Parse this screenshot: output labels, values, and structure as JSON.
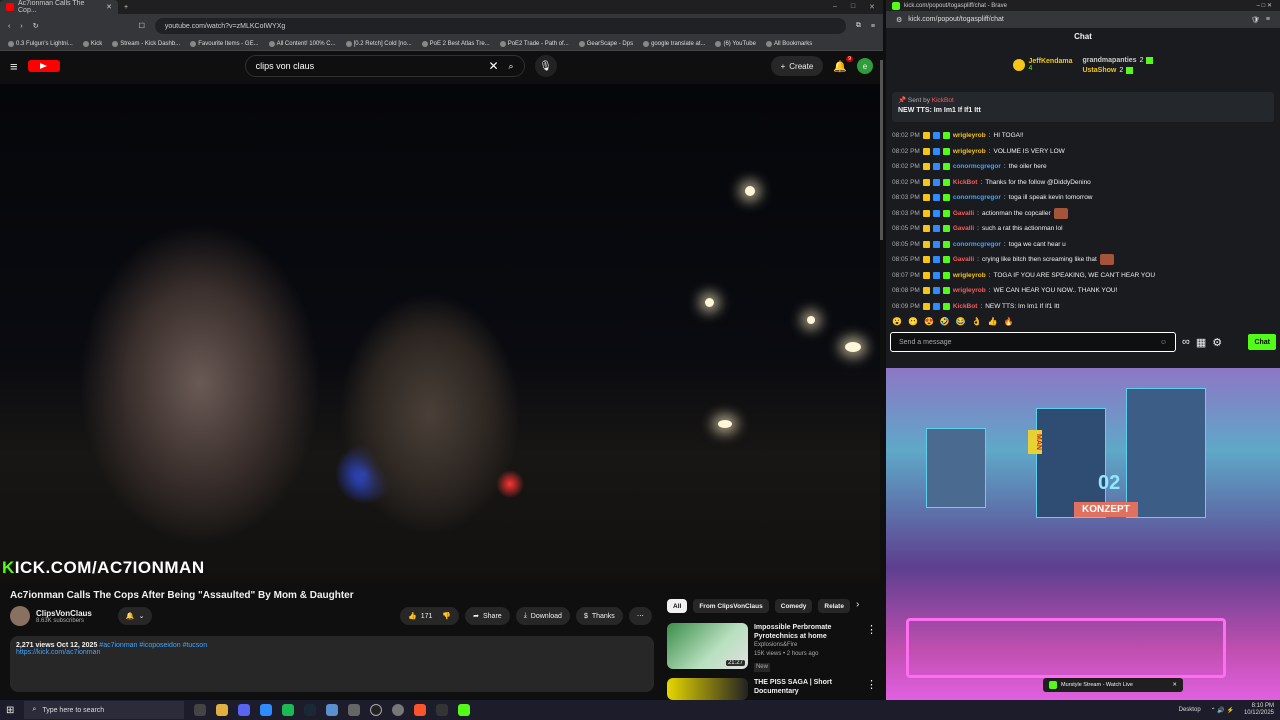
{
  "yt_browser": {
    "tab_title": "Ac7ionman Calls The Cop...",
    "url": "youtube.com/watch?v=zMLKCoIWYXg",
    "bookmarks": [
      "0.3 Fulgun's Lightni...",
      "Kick",
      "Stream - Kick Dashb...",
      "Favourite Items - GE...",
      "All Content! 100% C...",
      "[0.2 Retch] Cold [no...",
      "PoE 2 Best Atlas Tre...",
      "PoE2 Trade - Path of...",
      "GearScape - Dps",
      "google translate at...",
      "(6) YouTube",
      "All Bookmarks"
    ]
  },
  "youtube": {
    "search_query": "clips von claus",
    "create_label": "Create",
    "notif_count": "9",
    "avatar_letter": "e",
    "overlay_prefix": "K",
    "overlay_rest": "ICK.COM/AC7IONMAN",
    "video_title": "Ac7ionman Calls The Cops After Being \"Assaulted\" By Mom & Daughter",
    "channel_name": "ClipsVonClaus",
    "subscribers": "8.63K subscribers",
    "like_count": "171",
    "share_label": "Share",
    "download_label": "Download",
    "thanks_label": "Thanks",
    "desc_stats": "2,271 views  Oct 12, 2025",
    "desc_tags": "#ac7ionman #icoposeidon #tucson",
    "desc_link": "https://kick.com/ac7ionman",
    "chips": [
      "All",
      "From ClipsVonClaus",
      "Comedy",
      "Relate"
    ],
    "recs": [
      {
        "title": "Impossible Perbromate Pyrotechnics at home",
        "channel": "Explosions&Fire",
        "meta": "15K views • 2 hours ago",
        "badge": "New",
        "duration": "21:27"
      },
      {
        "title": "THE PISS SAGA | Short Documentary",
        "channel": "",
        "meta": "",
        "badge": "",
        "duration": ""
      }
    ]
  },
  "kick_browser": {
    "tab_title": "kick.com/popout/togaspliff/chat - Brave",
    "url": "kick.com/popout/togaspliff/chat"
  },
  "kick": {
    "header": "Chat",
    "leaderboard": [
      {
        "name": "JeffKendama",
        "value": "4"
      },
      {
        "name": "grandmapanties",
        "value": "2"
      },
      {
        "name": "UstaShow",
        "value": "2"
      }
    ],
    "pinned_by_prefix": "Sent by",
    "pinned_by_user": "KickBot",
    "pinned_message": "NEW TTS: Im Im1 If If1 Itt",
    "messages": [
      {
        "time": "08:02 PM",
        "user": "wrigleyrob",
        "color": "#f5c518",
        "text": "HI TOGA!!"
      },
      {
        "time": "08:02 PM",
        "user": "wrigleyrob",
        "color": "#f5c518",
        "text": "VOLUME IS VERY LOW"
      },
      {
        "time": "08:02 PM",
        "user": "conormcgregor",
        "color": "#3ea6ff",
        "text": "the oiler here"
      },
      {
        "time": "08:02 PM",
        "user": "KickBot",
        "color": "#ff5a5a",
        "text": "Thanks for the follow @DiddyDenino"
      },
      {
        "time": "08:03 PM",
        "user": "conormcgregor",
        "color": "#3ea6ff",
        "text": "toga ill speak kevin tomorrow"
      },
      {
        "time": "08:03 PM",
        "user": "Gavalli",
        "color": "#ff5a5a",
        "text": "actionman the copcaller"
      },
      {
        "time": "08:05 PM",
        "user": "Gavalli",
        "color": "#ff5a5a",
        "text": "such a rat this actionman lol"
      },
      {
        "time": "08:05 PM",
        "user": "conormcgregor",
        "color": "#3ea6ff",
        "text": "toga we cant hear u"
      },
      {
        "time": "08:05 PM",
        "user": "Gavalli",
        "color": "#ff5a5a",
        "text": "crying like bitch then screaming like that"
      },
      {
        "time": "08:07 PM",
        "user": "wrigleyrob",
        "color": "#f5c518",
        "text": "TOGA IF YOU ARE SPEAKING, WE CAN'T HEAR YOU"
      },
      {
        "time": "08:08 PM",
        "user": "wrigleyrob",
        "color": "#ff5a5a",
        "text": "WE CAN HEAR YOU NOW.. THANK YOU!"
      },
      {
        "time": "08:09 PM",
        "user": "KickBot",
        "color": "#ff5a5a",
        "text": "NEW TTS: Im Im1 If If1 Itt"
      }
    ],
    "send_placeholder": "Send a message",
    "chat_button": "Chat",
    "stream_sign_1": "MAN",
    "stream_sign_2": "02",
    "stream_sign_3": "KONZEPT",
    "mini_player": "Murstyle Stream - Watch Live"
  },
  "taskbar": {
    "search_placeholder": "Type here to search",
    "desktop_label": "Desktop",
    "time": "8:10 PM",
    "date": "10/12/2025"
  },
  "colors": {
    "kick_green": "#53fc18",
    "yt_red": "#ff0000",
    "link_blue": "#3ea6ff"
  }
}
